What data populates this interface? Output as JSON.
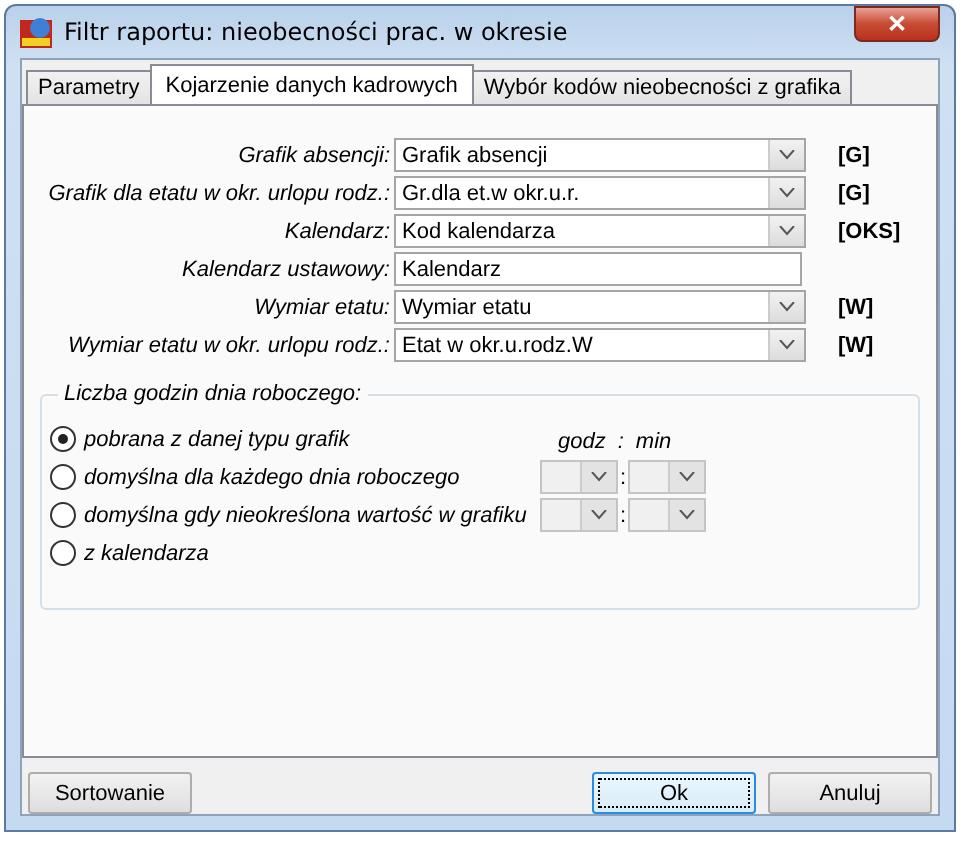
{
  "window": {
    "title": "Filtr raportu: nieobecności prac. w okresie",
    "close": "✕"
  },
  "tabs": [
    {
      "label": "Parametry",
      "selected": false
    },
    {
      "label": "Kojarzenie danych kadrowych",
      "selected": true
    },
    {
      "label": "Wybór kodów nieobecności z grafika",
      "selected": false
    }
  ],
  "fields": [
    {
      "label": "Grafik absencji:",
      "kind": "combo",
      "value": "Grafik absencji",
      "suffix": "[G]"
    },
    {
      "label": "Grafik dla etatu w okr. urlopu rodz.:",
      "kind": "combo",
      "value": "Gr.dla et.w okr.u.r.",
      "suffix": "[G]"
    },
    {
      "label": "Kalendarz:",
      "kind": "combo",
      "value": "Kod kalendarza",
      "suffix": "[OKS]"
    },
    {
      "label": "Kalendarz ustawowy:",
      "kind": "text",
      "value": "Kalendarz"
    },
    {
      "label": "Wymiar etatu:",
      "kind": "combo",
      "value": "Wymiar etatu",
      "suffix": "[W]"
    },
    {
      "label": "Wymiar etatu w okr. urlopu rodz.:",
      "kind": "combo",
      "value": "Etat w okr.u.rodz.W",
      "suffix": "[W]"
    }
  ],
  "group": {
    "title": "Liczba godzin dnia roboczego:",
    "time_header": {
      "hours": "godz",
      "separator": ":",
      "minutes": "min"
    },
    "options": [
      {
        "label": "pobrana z danej typu grafik",
        "selected": true
      },
      {
        "label": "domyślna dla każdego dnia roboczego",
        "selected": false,
        "time": {
          "separator": ":",
          "disabled": true
        }
      },
      {
        "label": "domyślna gdy nieokreślona wartość w grafiku",
        "selected": false,
        "time": {
          "separator": ":",
          "disabled": true
        }
      },
      {
        "label": "z kalendarza",
        "selected": false
      }
    ]
  },
  "buttons": [
    {
      "label": "Sortowanie",
      "kind": "left",
      "default": false
    },
    {
      "label": "Ok",
      "kind": "right",
      "default": true
    },
    {
      "label": "Anuluj",
      "kind": "right",
      "default": false
    }
  ]
}
